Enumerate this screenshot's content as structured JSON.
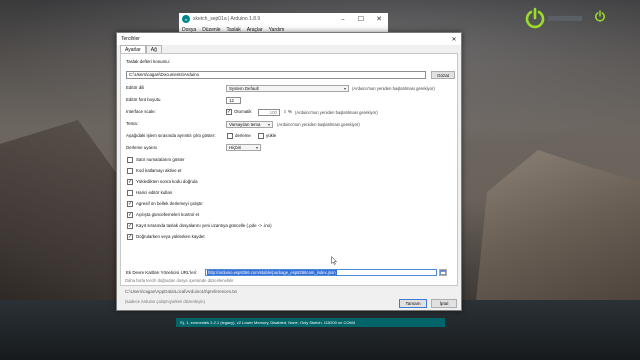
{
  "ide_window": {
    "logo": "∞",
    "title": "sketch_sep01a | Arduino 1.8.9",
    "menu": [
      "Dosya",
      "Düzenle",
      "Taslak",
      "Araçlar",
      "Yardım"
    ],
    "status_bar": "S), 1, ecmondek 2.2.1 (legacy), v2 Lower Memory, Disabled, None, Only Sketch, 115200 on COM4"
  },
  "dialog": {
    "title": "Tercihler",
    "close_glyph": "✕",
    "tabs": [
      {
        "label": "Ayarlar",
        "active": true
      },
      {
        "label": "Ağ",
        "active": false
      }
    ],
    "sketchbook": {
      "label": "Taslak defteri konumu:",
      "value": "C:\\Users\\cagan\\Documents\\Arduino",
      "browse_label": "Gözat"
    },
    "editor_language": {
      "label": "Editör dili",
      "value": "System Default",
      "note": "(Arduino'nun yeniden başlatılması gerekiyor)"
    },
    "editor_font_size": {
      "label": "Editör font boyutu",
      "value": "12"
    },
    "interface_scale": {
      "label": "Interface scale:",
      "auto_label": "Otomatik",
      "auto_checked": true,
      "value": "100",
      "unit": "%",
      "note": "(Arduino'nun yeniden başlatılması gerekiyor)"
    },
    "theme": {
      "label": "Tema:",
      "value": "Varsayılan tema",
      "note": "(Arduino'nun yeniden başlatılması gerekiyor)"
    },
    "verbose_output": {
      "label": "Aşağıdaki işlem sırasında ayrıntılı çıktı göster:",
      "compile_label": "derleme",
      "compile_checked": false,
      "upload_label": "yükle",
      "upload_checked": false
    },
    "compiler_warnings": {
      "label": "Derleme uyarısı",
      "value": "Hiçbiri"
    },
    "options": [
      {
        "label": "Satır numaralarını göster",
        "checked": false
      },
      {
        "label": "Kod katlamayı aktive et",
        "checked": false
      },
      {
        "label": "Yükledikten sonra kodu doğrula",
        "checked": true
      },
      {
        "label": "Harici editör kullan",
        "checked": false
      },
      {
        "label": "Agresif ön bellek derlemeyi çalıştır",
        "checked": true
      },
      {
        "label": "Açılışta güncellemeleri kontrol et",
        "checked": true
      },
      {
        "label": "Kayıt sırasında taslak dosyalarını yeni uzantıya güncelle (.pde -> .ino)",
        "checked": true
      },
      {
        "label": "Doğrularken veya yüklerken kaydet",
        "checked": true
      }
    ],
    "boards_manager": {
      "label": "Ek Devre Kartları Yöneticisi URL'leri:",
      "value": "http://arduino.esp8266.com/stable/package_esp8266com_index.json"
    },
    "more_prefs_note": "Daha fazla tercih doğrudan dosya içerisinde düzenlenebilir",
    "prefs_path": "C:\\Users\\cagan\\AppData\\Local\\Arduino15\\preferences.txt",
    "edit_note": "(sadece Arduino çalışmıyorken düzenleyin)",
    "ok_label": "Tamam",
    "cancel_label": "İptal"
  },
  "colors": {
    "selection": "#3670d9",
    "ide_teal": "#006468",
    "power_icon": "#9bdc2b"
  },
  "icons": [
    "power-icon",
    "arduino-logo-icon",
    "window-icon",
    "checkmark-icon",
    "mouse-pointer-icon"
  ]
}
